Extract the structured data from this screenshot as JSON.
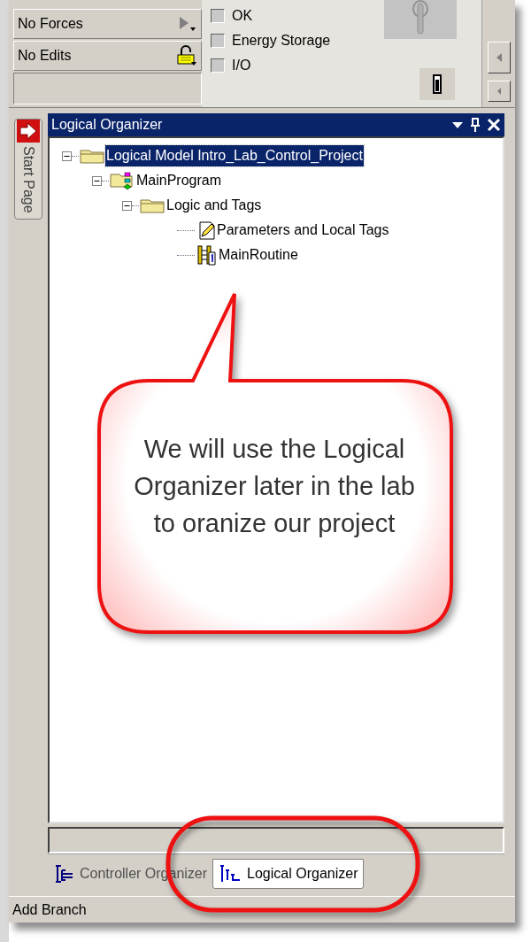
{
  "status_panel": {
    "rows": [
      {
        "label": "No Forces",
        "kind": "forces"
      },
      {
        "label": "No Edits",
        "kind": "edits"
      }
    ]
  },
  "indicators": [
    {
      "label": "OK",
      "checked": false
    },
    {
      "label": "Energy Storage",
      "checked": false
    },
    {
      "label": "I/O",
      "checked": false
    }
  ],
  "side_tabs": [
    {
      "label": "Start Page"
    }
  ],
  "organizer": {
    "title": "Logical Organizer",
    "tree": [
      {
        "label": "Logical Model Intro_Lab_Control_Project",
        "kind": "folder",
        "expanded": true,
        "selected": true,
        "children": [
          {
            "label": "MainProgram",
            "kind": "program",
            "expanded": true,
            "selected": false,
            "children": [
              {
                "label": "Logic and Tags",
                "kind": "folder",
                "expanded": true,
                "selected": false,
                "children": [
                  {
                    "label": "Parameters and Local Tags",
                    "kind": "tags",
                    "selected": false
                  },
                  {
                    "label": "MainRoutine",
                    "kind": "routine",
                    "selected": false
                  }
                ]
              }
            ]
          }
        ]
      }
    ]
  },
  "callout": {
    "text": "We will use the Logical Organizer later in the lab to oranize our project"
  },
  "tabs": [
    {
      "label": "Controller Organizer",
      "kind": "controller",
      "selected": false
    },
    {
      "label": "Logical Organizer",
      "kind": "logical",
      "selected": true
    }
  ],
  "status_bar": "Add Branch"
}
